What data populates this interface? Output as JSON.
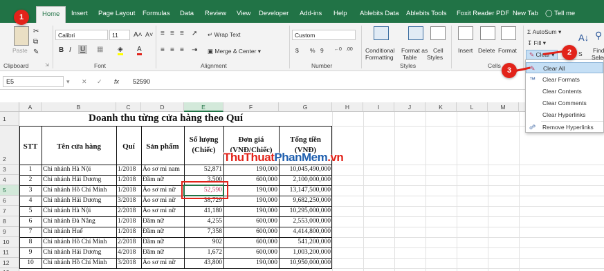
{
  "tabs": [
    {
      "label": "Home",
      "active": true
    },
    {
      "label": "Insert"
    },
    {
      "label": "Page Layout"
    },
    {
      "label": "Formulas"
    },
    {
      "label": "Data"
    },
    {
      "label": "Review"
    },
    {
      "label": "View"
    },
    {
      "label": "Developer"
    },
    {
      "label": "Add-ins"
    },
    {
      "label": "Help"
    },
    {
      "label": "Ablebits Data"
    },
    {
      "label": "Ablebits Tools"
    },
    {
      "label": "Foxit Reader PDF"
    },
    {
      "label": "New Tab"
    }
  ],
  "tell_me": "Tell me",
  "ribbon": {
    "clipboard": {
      "paste": "Paste",
      "label": "Clipboard"
    },
    "font": {
      "name": "Calibri",
      "size": "11",
      "grow": "A˄",
      "shrink": "A˅",
      "bold": "B",
      "italic": "I",
      "underline": "U",
      "label": "Font"
    },
    "alignment": {
      "wrap": "Wrap Text",
      "merge": "Merge & Center",
      "label": "Alignment"
    },
    "number": {
      "format": "Custom",
      "currency": "$",
      "percent": "%",
      "comma": "9",
      "label": "Number"
    },
    "styles": {
      "cond": "Conditional",
      "cond2": "Formatting",
      "fmt": "Format as",
      "fmt2": "Table",
      "cell": "Cell",
      "cell2": "Styles",
      "label": "Styles"
    },
    "cells": {
      "insert": "Insert",
      "delete": "Delete",
      "format": "Format",
      "label": "Cells"
    },
    "editing": {
      "autosum": "AutoSum",
      "fill": "Fill",
      "clear": "Clear",
      "sort": "S",
      "find": "Find",
      "select": "Selec"
    }
  },
  "formula_bar": {
    "name_box": "E5",
    "cancel": "✕",
    "enter": "✓",
    "fx": "fx",
    "value": "52590"
  },
  "columns": [
    "A",
    "B",
    "C",
    "D",
    "E",
    "F",
    "G",
    "H",
    "I",
    "J",
    "K",
    "L",
    "M"
  ],
  "rows": [
    "1",
    "2",
    "3",
    "4",
    "5",
    "6",
    "7",
    "8",
    "9",
    "10",
    "11",
    "12",
    "13"
  ],
  "sheet": {
    "title": "Doanh thu từng cửa hàng theo Quí",
    "headers": {
      "stt": "STT",
      "store": "Tên cửa hàng",
      "quarter": "Quí",
      "product": "Sản phẩm",
      "qty1": "Số lượng",
      "qty2": "(Chiếc)",
      "price1": "Đơn giá",
      "price2": "(VNĐ/Chiếc)",
      "total1": "Tổng tiền",
      "total2": "(VNĐ)"
    },
    "data": [
      [
        "1",
        "Chi nhánh Hà Nội",
        "1/2018",
        "Áo sơ mi nam",
        "52,871",
        "190,000",
        "10,045,490,000"
      ],
      [
        "2",
        "Chi nhánh Hải Dương",
        "1/2018",
        "Đầm nữ",
        "3,500",
        "600,000",
        "2,100,000,000"
      ],
      [
        "3",
        "Chi nhánh Hồ Chí Minh",
        "1/2018",
        "Áo sơ mi nữ",
        "52,590",
        "190,000",
        "13,147,500,000"
      ],
      [
        "4",
        "Chi nhánh Hải Dương",
        "3/2018",
        "Áo sơ mi nữ",
        "38,729",
        "190,000",
        "9,682,250,000"
      ],
      [
        "5",
        "Chi nhánh Hà Nội",
        "2/2018",
        "Áo sơ mi nữ",
        "41,180",
        "190,000",
        "10,295,000,000"
      ],
      [
        "6",
        "Chi nhánh Đà Nẵng",
        "1/2018",
        "Đầm nữ",
        "4,255",
        "600,000",
        "2,553,000,000"
      ],
      [
        "7",
        "Chi nhánh Huế",
        "1/2018",
        "Đầm nữ",
        "7,358",
        "600,000",
        "4,414,800,000"
      ],
      [
        "8",
        "Chi nhánh Hồ Chí Minh",
        "2/2018",
        "Đầm nữ",
        "902",
        "600,000",
        "541,200,000"
      ],
      [
        "9",
        "Chi nhánh Hải Dương",
        "4/2018",
        "Đầm nữ",
        "1,672",
        "600,000",
        "1,003,200,000"
      ],
      [
        "10",
        "Chi nhánh Hồ Chí Minh",
        "3/2018",
        "Áo sơ mi nữ",
        "43,800",
        "190,000",
        "10,950,000,000"
      ]
    ]
  },
  "clear_menu": {
    "items": [
      {
        "label": "Clear All",
        "highlight": true,
        "icon": "eraser-icon"
      },
      {
        "label": "Clear Formats",
        "icon": "clear-formats-icon"
      },
      {
        "label": "Clear Contents"
      },
      {
        "label": "Clear Comments"
      },
      {
        "label": "Clear Hyperlinks"
      },
      {
        "label": "Remove Hyperlinks",
        "icon": "remove-hyperlink-icon"
      }
    ]
  },
  "callouts": [
    "1",
    "2",
    "3"
  ],
  "watermark": {
    "part1": "ThuThuat",
    "part2": "PhanMem",
    "part3": ".vn"
  },
  "colors": {
    "excel_green": "#217346",
    "callout_red": "#e2231a",
    "menu_highlight": "#c5dff5"
  }
}
